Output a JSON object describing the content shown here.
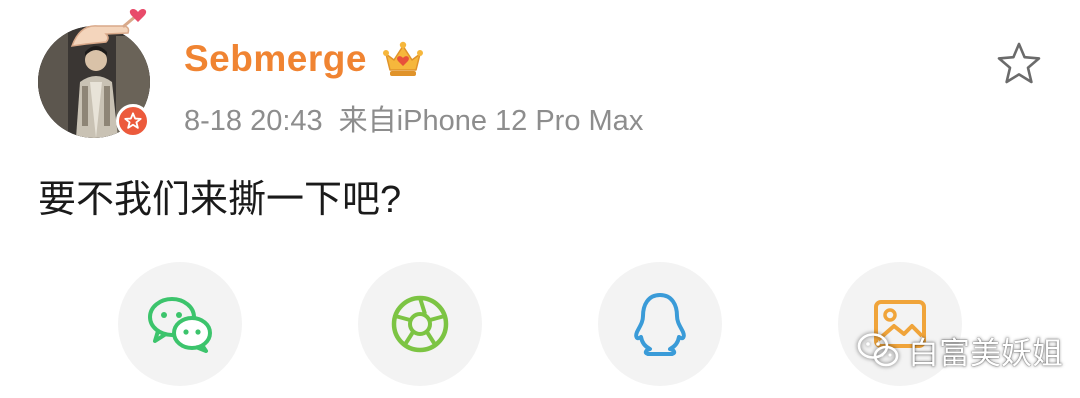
{
  "post": {
    "username": "Sebmerge",
    "time": "8-18 20:43",
    "source": "来自iPhone 12 Pro Max",
    "text": "要不我们来撕一下吧?"
  },
  "icons": {
    "favorite": "star-outline-icon",
    "verified": "vip-crown-icon",
    "user_badge": "star-badge-icon"
  },
  "share": [
    {
      "name": "wechat",
      "icon": "wechat-icon",
      "color": "#3cc46c"
    },
    {
      "name": "moments",
      "icon": "moments-aperture-icon",
      "color": "#7cc443"
    },
    {
      "name": "qq",
      "icon": "qq-penguin-icon",
      "color": "#3a9bd8"
    },
    {
      "name": "save-image",
      "icon": "image-icon",
      "color": "#f0a43a"
    }
  ],
  "watermark": {
    "text": "白富美妖姐"
  },
  "colors": {
    "username": "#f08432",
    "meta": "#8d8d8d",
    "badge": "#ec5a3c"
  }
}
